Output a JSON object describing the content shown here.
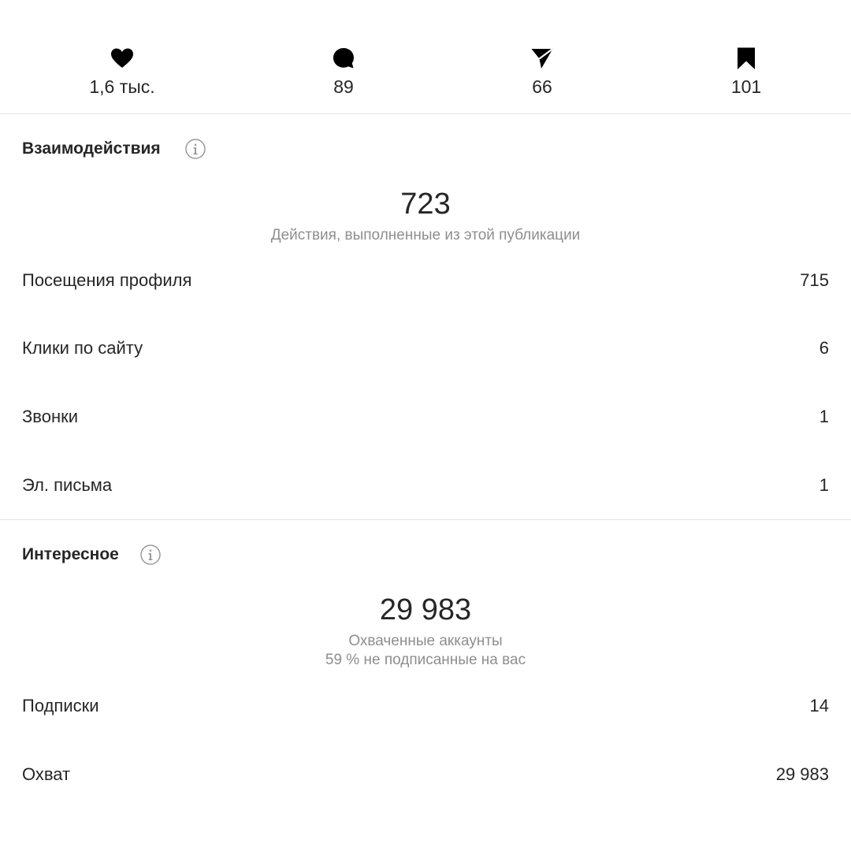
{
  "stats": {
    "likes": "1,6 тыс.",
    "comments": "89",
    "shares": "66",
    "saves": "101"
  },
  "interactions": {
    "title": "Взаимодействия",
    "total": "723",
    "caption": "Действия, выполненные из этой публикации",
    "rows": [
      {
        "label": "Посещения профиля",
        "value": "715"
      },
      {
        "label": "Клики по сайту",
        "value": "6"
      },
      {
        "label": "Звонки",
        "value": "1"
      },
      {
        "label": "Эл. письма",
        "value": "1"
      }
    ]
  },
  "discovery": {
    "title": "Интересное",
    "total": "29 983",
    "caption": "Охваченные аккаунты",
    "caption2": "59 % не подписанные на вас",
    "rows": [
      {
        "label": "Подписки",
        "value": "14"
      },
      {
        "label": "Охват",
        "value": "29 983"
      }
    ]
  },
  "colors": {
    "text": "#262626",
    "muted": "#8e8e8e",
    "divider": "#e3e3e3"
  }
}
